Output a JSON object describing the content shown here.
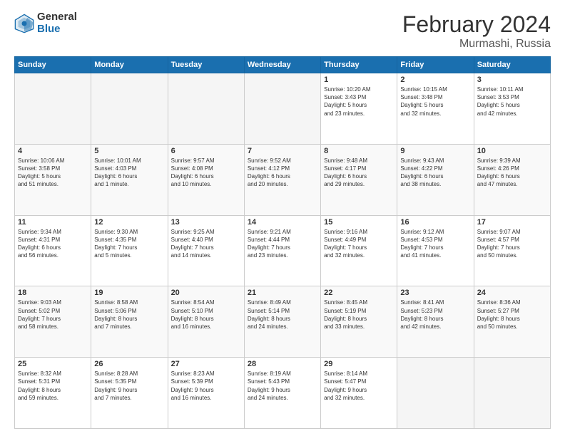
{
  "logo": {
    "text_general": "General",
    "text_blue": "Blue"
  },
  "header": {
    "title": "February 2024",
    "subtitle": "Murmashi, Russia"
  },
  "weekdays": [
    "Sunday",
    "Monday",
    "Tuesday",
    "Wednesday",
    "Thursday",
    "Friday",
    "Saturday"
  ],
  "weeks": [
    [
      {
        "day": "",
        "info": ""
      },
      {
        "day": "",
        "info": ""
      },
      {
        "day": "",
        "info": ""
      },
      {
        "day": "",
        "info": ""
      },
      {
        "day": "1",
        "info": "Sunrise: 10:20 AM\nSunset: 3:43 PM\nDaylight: 5 hours\nand 23 minutes."
      },
      {
        "day": "2",
        "info": "Sunrise: 10:15 AM\nSunset: 3:48 PM\nDaylight: 5 hours\nand 32 minutes."
      },
      {
        "day": "3",
        "info": "Sunrise: 10:11 AM\nSunset: 3:53 PM\nDaylight: 5 hours\nand 42 minutes."
      }
    ],
    [
      {
        "day": "4",
        "info": "Sunrise: 10:06 AM\nSunset: 3:58 PM\nDaylight: 5 hours\nand 51 minutes."
      },
      {
        "day": "5",
        "info": "Sunrise: 10:01 AM\nSunset: 4:03 PM\nDaylight: 6 hours\nand 1 minute."
      },
      {
        "day": "6",
        "info": "Sunrise: 9:57 AM\nSunset: 4:08 PM\nDaylight: 6 hours\nand 10 minutes."
      },
      {
        "day": "7",
        "info": "Sunrise: 9:52 AM\nSunset: 4:12 PM\nDaylight: 6 hours\nand 20 minutes."
      },
      {
        "day": "8",
        "info": "Sunrise: 9:48 AM\nSunset: 4:17 PM\nDaylight: 6 hours\nand 29 minutes."
      },
      {
        "day": "9",
        "info": "Sunrise: 9:43 AM\nSunset: 4:22 PM\nDaylight: 6 hours\nand 38 minutes."
      },
      {
        "day": "10",
        "info": "Sunrise: 9:39 AM\nSunset: 4:26 PM\nDaylight: 6 hours\nand 47 minutes."
      }
    ],
    [
      {
        "day": "11",
        "info": "Sunrise: 9:34 AM\nSunset: 4:31 PM\nDaylight: 6 hours\nand 56 minutes."
      },
      {
        "day": "12",
        "info": "Sunrise: 9:30 AM\nSunset: 4:35 PM\nDaylight: 7 hours\nand 5 minutes."
      },
      {
        "day": "13",
        "info": "Sunrise: 9:25 AM\nSunset: 4:40 PM\nDaylight: 7 hours\nand 14 minutes."
      },
      {
        "day": "14",
        "info": "Sunrise: 9:21 AM\nSunset: 4:44 PM\nDaylight: 7 hours\nand 23 minutes."
      },
      {
        "day": "15",
        "info": "Sunrise: 9:16 AM\nSunset: 4:49 PM\nDaylight: 7 hours\nand 32 minutes."
      },
      {
        "day": "16",
        "info": "Sunrise: 9:12 AM\nSunset: 4:53 PM\nDaylight: 7 hours\nand 41 minutes."
      },
      {
        "day": "17",
        "info": "Sunrise: 9:07 AM\nSunset: 4:57 PM\nDaylight: 7 hours\nand 50 minutes."
      }
    ],
    [
      {
        "day": "18",
        "info": "Sunrise: 9:03 AM\nSunset: 5:02 PM\nDaylight: 7 hours\nand 58 minutes."
      },
      {
        "day": "19",
        "info": "Sunrise: 8:58 AM\nSunset: 5:06 PM\nDaylight: 8 hours\nand 7 minutes."
      },
      {
        "day": "20",
        "info": "Sunrise: 8:54 AM\nSunset: 5:10 PM\nDaylight: 8 hours\nand 16 minutes."
      },
      {
        "day": "21",
        "info": "Sunrise: 8:49 AM\nSunset: 5:14 PM\nDaylight: 8 hours\nand 24 minutes."
      },
      {
        "day": "22",
        "info": "Sunrise: 8:45 AM\nSunset: 5:19 PM\nDaylight: 8 hours\nand 33 minutes."
      },
      {
        "day": "23",
        "info": "Sunrise: 8:41 AM\nSunset: 5:23 PM\nDaylight: 8 hours\nand 42 minutes."
      },
      {
        "day": "24",
        "info": "Sunrise: 8:36 AM\nSunset: 5:27 PM\nDaylight: 8 hours\nand 50 minutes."
      }
    ],
    [
      {
        "day": "25",
        "info": "Sunrise: 8:32 AM\nSunset: 5:31 PM\nDaylight: 8 hours\nand 59 minutes."
      },
      {
        "day": "26",
        "info": "Sunrise: 8:28 AM\nSunset: 5:35 PM\nDaylight: 9 hours\nand 7 minutes."
      },
      {
        "day": "27",
        "info": "Sunrise: 8:23 AM\nSunset: 5:39 PM\nDaylight: 9 hours\nand 16 minutes."
      },
      {
        "day": "28",
        "info": "Sunrise: 8:19 AM\nSunset: 5:43 PM\nDaylight: 9 hours\nand 24 minutes."
      },
      {
        "day": "29",
        "info": "Sunrise: 8:14 AM\nSunset: 5:47 PM\nDaylight: 9 hours\nand 32 minutes."
      },
      {
        "day": "",
        "info": ""
      },
      {
        "day": "",
        "info": ""
      }
    ]
  ]
}
